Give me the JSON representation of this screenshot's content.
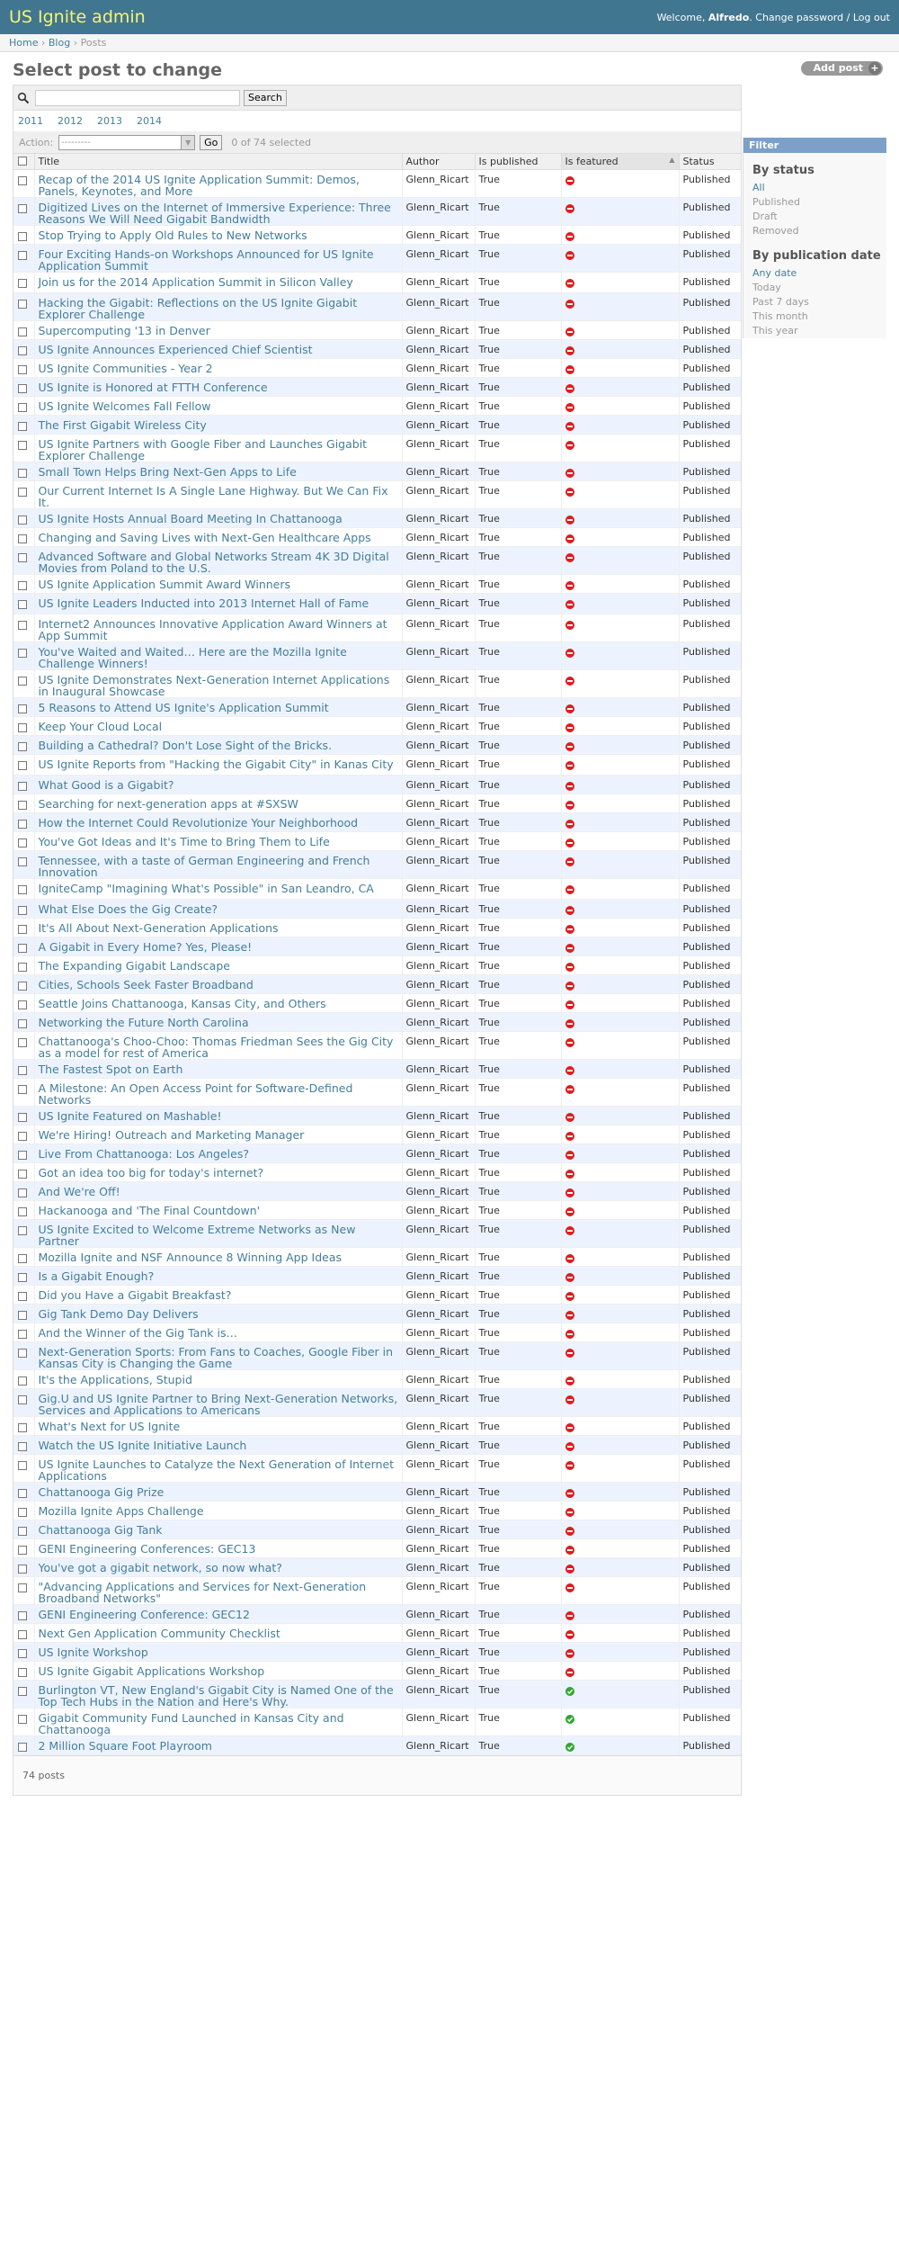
{
  "header": {
    "branding": "US Ignite admin",
    "welcome": "Welcome,",
    "username": "Alfredo",
    "change_password": "Change password",
    "separator": " / ",
    "logout": "Log out"
  },
  "breadcrumbs": {
    "home": "Home",
    "blog": "Blog",
    "current": "Posts",
    "sep": " › "
  },
  "page": {
    "title": "Select post to change",
    "add_post": "Add post",
    "add_icon": "+"
  },
  "search": {
    "button": "Search",
    "placeholder": ""
  },
  "date_hierarchy": [
    "2011",
    "2012",
    "2013",
    "2014"
  ],
  "actions": {
    "label": "Action:",
    "selected": "---------",
    "go": "Go",
    "counter": "0 of 74 selected"
  },
  "columns": [
    "Title",
    "Author",
    "Is published",
    "Is featured",
    "Status"
  ],
  "posts": [
    {
      "title": "Recap of the 2014 US Ignite Application Summit: Demos, Panels, Keynotes, and More",
      "author": "Glenn_Ricart",
      "published": "True",
      "featured": false,
      "status": "Published"
    },
    {
      "title": "Digitized Lives on the Internet of Immersive Experience: Three Reasons We Will Need Gigabit Bandwidth",
      "author": "Glenn_Ricart",
      "published": "True",
      "featured": false,
      "status": "Published"
    },
    {
      "title": "Stop Trying to Apply Old Rules to New Networks",
      "author": "Glenn_Ricart",
      "published": "True",
      "featured": false,
      "status": "Published"
    },
    {
      "title": "Four Exciting Hands-on Workshops Announced for US Ignite Application Summit",
      "author": "Glenn_Ricart",
      "published": "True",
      "featured": false,
      "status": "Published"
    },
    {
      "title": "Join us for the 2014 Application Summit in Silicon Valley",
      "author": "Glenn_Ricart",
      "published": "True",
      "featured": false,
      "status": "Published"
    },
    {
      "title": "Hacking the Gigabit: Reflections on the US Ignite Gigabit Explorer Challenge",
      "author": "Glenn_Ricart",
      "published": "True",
      "featured": false,
      "status": "Published"
    },
    {
      "title": "Supercomputing '13 in Denver",
      "author": "Glenn_Ricart",
      "published": "True",
      "featured": false,
      "status": "Published"
    },
    {
      "title": "US Ignite Announces Experienced Chief Scientist",
      "author": "Glenn_Ricart",
      "published": "True",
      "featured": false,
      "status": "Published"
    },
    {
      "title": "US Ignite Communities - Year 2",
      "author": "Glenn_Ricart",
      "published": "True",
      "featured": false,
      "status": "Published"
    },
    {
      "title": "US Ignite is Honored at FTTH Conference",
      "author": "Glenn_Ricart",
      "published": "True",
      "featured": false,
      "status": "Published"
    },
    {
      "title": "US Ignite Welcomes Fall Fellow",
      "author": "Glenn_Ricart",
      "published": "True",
      "featured": false,
      "status": "Published"
    },
    {
      "title": "The First Gigabit Wireless City",
      "author": "Glenn_Ricart",
      "published": "True",
      "featured": false,
      "status": "Published"
    },
    {
      "title": "US Ignite Partners with Google Fiber and Launches Gigabit Explorer Challenge",
      "author": "Glenn_Ricart",
      "published": "True",
      "featured": false,
      "status": "Published"
    },
    {
      "title": "Small Town Helps Bring Next-Gen Apps to Life",
      "author": "Glenn_Ricart",
      "published": "True",
      "featured": false,
      "status": "Published"
    },
    {
      "title": "Our Current Internet Is A Single Lane Highway. But We Can Fix It.",
      "author": "Glenn_Ricart",
      "published": "True",
      "featured": false,
      "status": "Published"
    },
    {
      "title": "US Ignite Hosts Annual Board Meeting In Chattanooga",
      "author": "Glenn_Ricart",
      "published": "True",
      "featured": false,
      "status": "Published"
    },
    {
      "title": "Changing and Saving Lives with Next-Gen Healthcare Apps",
      "author": "Glenn_Ricart",
      "published": "True",
      "featured": false,
      "status": "Published"
    },
    {
      "title": "Advanced Software and Global Networks Stream 4K 3D Digital Movies from Poland to the U.S.",
      "author": "Glenn_Ricart",
      "published": "True",
      "featured": false,
      "status": "Published"
    },
    {
      "title": "US Ignite Application Summit Award Winners",
      "author": "Glenn_Ricart",
      "published": "True",
      "featured": false,
      "status": "Published"
    },
    {
      "title": "US Ignite Leaders Inducted into 2013 Internet Hall of Fame",
      "author": "Glenn_Ricart",
      "published": "True",
      "featured": false,
      "status": "Published"
    },
    {
      "title": "Internet2 Announces Innovative Application Award Winners at App Summit",
      "author": "Glenn_Ricart",
      "published": "True",
      "featured": false,
      "status": "Published"
    },
    {
      "title": "You've Waited and Waited… Here are the Mozilla Ignite Challenge Winners!",
      "author": "Glenn_Ricart",
      "published": "True",
      "featured": false,
      "status": "Published"
    },
    {
      "title": "US Ignite Demonstrates Next-Generation Internet Applications in Inaugural Showcase",
      "author": "Glenn_Ricart",
      "published": "True",
      "featured": false,
      "status": "Published"
    },
    {
      "title": "5 Reasons to Attend US Ignite's Application Summit",
      "author": "Glenn_Ricart",
      "published": "True",
      "featured": false,
      "status": "Published"
    },
    {
      "title": "Keep Your Cloud Local",
      "author": "Glenn_Ricart",
      "published": "True",
      "featured": false,
      "status": "Published"
    },
    {
      "title": "Building a Cathedral? Don't Lose Sight of the Bricks.",
      "author": "Glenn_Ricart",
      "published": "True",
      "featured": false,
      "status": "Published"
    },
    {
      "title": "US Ignite Reports from \"Hacking the Gigabit City\" in Kanas City",
      "author": "Glenn_Ricart",
      "published": "True",
      "featured": false,
      "status": "Published"
    },
    {
      "title": "What Good is a Gigabit?",
      "author": "Glenn_Ricart",
      "published": "True",
      "featured": false,
      "status": "Published"
    },
    {
      "title": "Searching for next-generation apps at #SXSW",
      "author": "Glenn_Ricart",
      "published": "True",
      "featured": false,
      "status": "Published"
    },
    {
      "title": "How the Internet Could Revolutionize Your Neighborhood",
      "author": "Glenn_Ricart",
      "published": "True",
      "featured": false,
      "status": "Published"
    },
    {
      "title": "You've Got Ideas and It's Time to Bring Them to Life",
      "author": "Glenn_Ricart",
      "published": "True",
      "featured": false,
      "status": "Published"
    },
    {
      "title": "Tennessee, with a taste of German Engineering and French Innovation",
      "author": "Glenn_Ricart",
      "published": "True",
      "featured": false,
      "status": "Published"
    },
    {
      "title": "IgniteCamp \"Imagining What's Possible\" in San Leandro, CA",
      "author": "Glenn_Ricart",
      "published": "True",
      "featured": false,
      "status": "Published"
    },
    {
      "title": "What Else Does the Gig Create?",
      "author": "Glenn_Ricart",
      "published": "True",
      "featured": false,
      "status": "Published"
    },
    {
      "title": "It's All About Next-Generation Applications",
      "author": "Glenn_Ricart",
      "published": "True",
      "featured": false,
      "status": "Published"
    },
    {
      "title": "A Gigabit in Every Home? Yes, Please!",
      "author": "Glenn_Ricart",
      "published": "True",
      "featured": false,
      "status": "Published"
    },
    {
      "title": "The Expanding Gigabit Landscape",
      "author": "Glenn_Ricart",
      "published": "True",
      "featured": false,
      "status": "Published"
    },
    {
      "title": "Cities, Schools Seek Faster Broadband",
      "author": "Glenn_Ricart",
      "published": "True",
      "featured": false,
      "status": "Published"
    },
    {
      "title": "Seattle Joins Chattanooga, Kansas City, and Others",
      "author": "Glenn_Ricart",
      "published": "True",
      "featured": false,
      "status": "Published"
    },
    {
      "title": "Networking the Future North Carolina",
      "author": "Glenn_Ricart",
      "published": "True",
      "featured": false,
      "status": "Published"
    },
    {
      "title": "Chattanooga's Choo-Choo: Thomas Friedman Sees the Gig City as a model for rest of America",
      "author": "Glenn_Ricart",
      "published": "True",
      "featured": false,
      "status": "Published"
    },
    {
      "title": "The Fastest Spot on Earth",
      "author": "Glenn_Ricart",
      "published": "True",
      "featured": false,
      "status": "Published"
    },
    {
      "title": "A Milestone: An Open Access Point for Software-Defined Networks",
      "author": "Glenn_Ricart",
      "published": "True",
      "featured": false,
      "status": "Published"
    },
    {
      "title": "US Ignite Featured on Mashable!",
      "author": "Glenn_Ricart",
      "published": "True",
      "featured": false,
      "status": "Published"
    },
    {
      "title": "We're Hiring! Outreach and Marketing Manager",
      "author": "Glenn_Ricart",
      "published": "True",
      "featured": false,
      "status": "Published"
    },
    {
      "title": "Live From Chattanooga: Los Angeles?",
      "author": "Glenn_Ricart",
      "published": "True",
      "featured": false,
      "status": "Published"
    },
    {
      "title": "Got an idea too big for today's internet?",
      "author": "Glenn_Ricart",
      "published": "True",
      "featured": false,
      "status": "Published"
    },
    {
      "title": "And We're Off!",
      "author": "Glenn_Ricart",
      "published": "True",
      "featured": false,
      "status": "Published"
    },
    {
      "title": "Hackanooga and 'The Final Countdown'",
      "author": "Glenn_Ricart",
      "published": "True",
      "featured": false,
      "status": "Published"
    },
    {
      "title": "US Ignite Excited to Welcome Extreme Networks as New Partner",
      "author": "Glenn_Ricart",
      "published": "True",
      "featured": false,
      "status": "Published"
    },
    {
      "title": "Mozilla Ignite and NSF Announce 8 Winning App Ideas",
      "author": "Glenn_Ricart",
      "published": "True",
      "featured": false,
      "status": "Published"
    },
    {
      "title": "Is a Gigabit Enough?",
      "author": "Glenn_Ricart",
      "published": "True",
      "featured": false,
      "status": "Published"
    },
    {
      "title": "Did you Have a Gigabit Breakfast?",
      "author": "Glenn_Ricart",
      "published": "True",
      "featured": false,
      "status": "Published"
    },
    {
      "title": "Gig Tank Demo Day Delivers",
      "author": "Glenn_Ricart",
      "published": "True",
      "featured": false,
      "status": "Published"
    },
    {
      "title": "And the Winner of the Gig Tank is…",
      "author": "Glenn_Ricart",
      "published": "True",
      "featured": false,
      "status": "Published"
    },
    {
      "title": "Next-Generation Sports: From Fans to Coaches, Google Fiber in Kansas City is Changing the Game",
      "author": "Glenn_Ricart",
      "published": "True",
      "featured": false,
      "status": "Published"
    },
    {
      "title": "It's the Applications, Stupid",
      "author": "Glenn_Ricart",
      "published": "True",
      "featured": false,
      "status": "Published"
    },
    {
      "title": "Gig.U and US Ignite Partner to Bring Next-Generation Networks, Services and Applications to Americans",
      "author": "Glenn_Ricart",
      "published": "True",
      "featured": false,
      "status": "Published"
    },
    {
      "title": "What's Next for US Ignite",
      "author": "Glenn_Ricart",
      "published": "True",
      "featured": false,
      "status": "Published"
    },
    {
      "title": "Watch the US Ignite Initiative Launch",
      "author": "Glenn_Ricart",
      "published": "True",
      "featured": false,
      "status": "Published"
    },
    {
      "title": "US Ignite Launches to Catalyze the Next Generation of Internet Applications",
      "author": "Glenn_Ricart",
      "published": "True",
      "featured": false,
      "status": "Published"
    },
    {
      "title": "Chattanooga Gig Prize",
      "author": "Glenn_Ricart",
      "published": "True",
      "featured": false,
      "status": "Published"
    },
    {
      "title": "Mozilla Ignite Apps Challenge",
      "author": "Glenn_Ricart",
      "published": "True",
      "featured": false,
      "status": "Published"
    },
    {
      "title": "Chattanooga Gig Tank",
      "author": "Glenn_Ricart",
      "published": "True",
      "featured": false,
      "status": "Published"
    },
    {
      "title": "GENI Engineering Conferences: GEC13",
      "author": "Glenn_Ricart",
      "published": "True",
      "featured": false,
      "status": "Published"
    },
    {
      "title": "You've got a gigabit network, so now what?",
      "author": "Glenn_Ricart",
      "published": "True",
      "featured": false,
      "status": "Published"
    },
    {
      "title": "\"Advancing Applications and Services for Next-Generation Broadband Networks\"",
      "author": "Glenn_Ricart",
      "published": "True",
      "featured": false,
      "status": "Published"
    },
    {
      "title": "GENI Engineering Conference: GEC12",
      "author": "Glenn_Ricart",
      "published": "True",
      "featured": false,
      "status": "Published"
    },
    {
      "title": "Next Gen Application Community Checklist",
      "author": "Glenn_Ricart",
      "published": "True",
      "featured": false,
      "status": "Published"
    },
    {
      "title": "US Ignite Workshop",
      "author": "Glenn_Ricart",
      "published": "True",
      "featured": false,
      "status": "Published"
    },
    {
      "title": "US Ignite Gigabit Applications Workshop",
      "author": "Glenn_Ricart",
      "published": "True",
      "featured": false,
      "status": "Published"
    },
    {
      "title": "Burlington VT, New England's Gigabit City is Named One of the Top Tech Hubs in the Nation and Here's Why.",
      "author": "Glenn_Ricart",
      "published": "True",
      "featured": true,
      "status": "Published"
    },
    {
      "title": "Gigabit Community Fund Launched in Kansas City and Chattanooga",
      "author": "Glenn_Ricart",
      "published": "True",
      "featured": true,
      "status": "Published"
    },
    {
      "title": "2 Million Square Foot Playroom",
      "author": "Glenn_Ricart",
      "published": "True",
      "featured": true,
      "status": "Published"
    }
  ],
  "paginator": "74 posts",
  "filter": {
    "title": "Filter",
    "by_status": "By status",
    "status_options": [
      "All",
      "Published",
      "Draft",
      "Removed"
    ],
    "status_selected": 0,
    "by_date": "By publication date",
    "date_options": [
      "Any date",
      "Today",
      "Past 7 days",
      "This month",
      "This year"
    ],
    "date_selected": 0
  },
  "colors": {
    "header_bg": "#417690",
    "branding": "#f4f379",
    "link": "#447e9b",
    "filter_header": "#7ca0c7",
    "row_alt": "#edf3fe",
    "not_featured": "#dd1e1e",
    "featured": "#2fa82f"
  }
}
